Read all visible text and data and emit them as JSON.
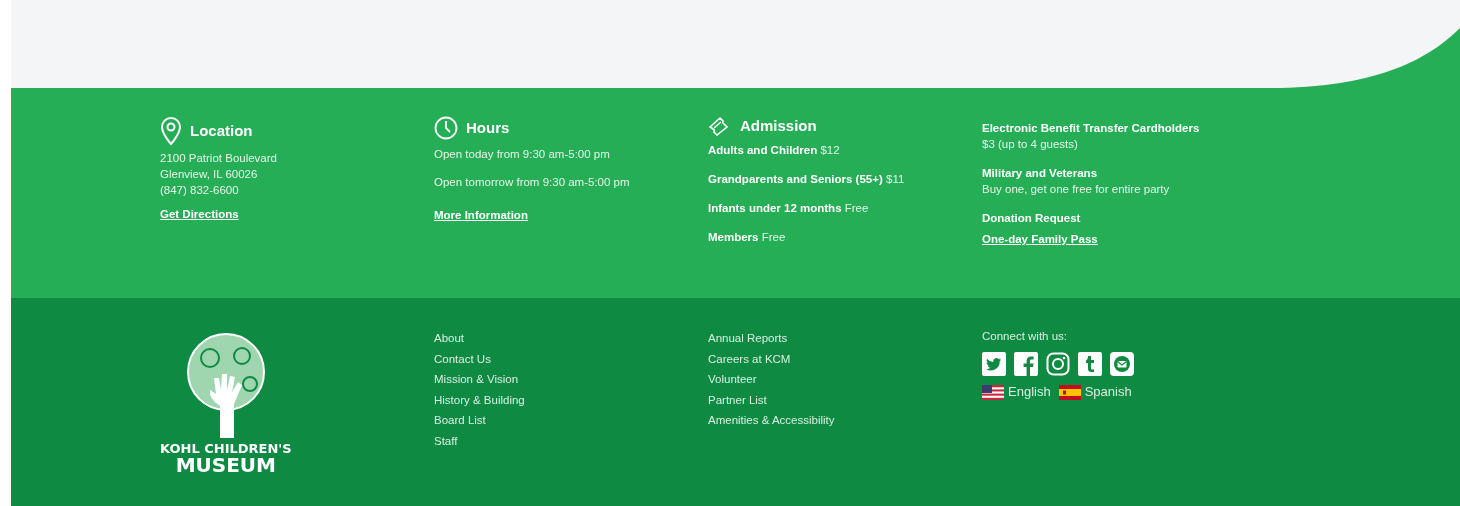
{
  "location": {
    "title": "Location",
    "lines": [
      "2100 Patriot Boulevard",
      "Glenview, IL 60026",
      "(847) 832-6600"
    ],
    "link": "Get Directions"
  },
  "hours": {
    "title": "Hours",
    "lines": [
      "Open today from 9:30 am-5:00 pm",
      "Open tomorrow from 9:30 am-5:00 pm"
    ],
    "link": "More Information"
  },
  "admission": {
    "title": "Admission",
    "items": [
      {
        "label": "Adults and Children",
        "value": "$12"
      },
      {
        "label": "Grandparents and Seniors (55+)",
        "value": "$11"
      },
      {
        "label": "Infants under 12 months",
        "value": "Free"
      },
      {
        "label": "Members",
        "value": "Free"
      }
    ]
  },
  "programs": [
    {
      "label": "Electronic Benefit Transfer Cardholders",
      "text": "$3 (up to 4 guests)"
    },
    {
      "label": "Military and Veterans",
      "text": "Buy one, get one free for entire party"
    },
    {
      "label": "Donation Request",
      "link": "One-day Family Pass"
    }
  ],
  "footer": {
    "logo_lines": [
      "KOHL CHILDREN'S",
      "MUSEUM"
    ],
    "links_1": [
      "About",
      "Contact Us",
      "Mission & Vision",
      "History & Building",
      "Board List",
      "Staff"
    ],
    "links_2": [
      "Annual Reports",
      "Careers at KCM",
      "Volunteer",
      "Partner List",
      "Amenities & Accessibility"
    ],
    "connect_label": "Connect with us:",
    "social": [
      {
        "kind": "twitter"
      },
      {
        "kind": "facebook"
      },
      {
        "kind": "instagram"
      },
      {
        "kind": "tumblr"
      },
      {
        "kind": "email"
      }
    ],
    "languages": [
      {
        "label": "English",
        "kind": "us"
      },
      {
        "label": "Spanish",
        "kind": "es"
      }
    ]
  }
}
